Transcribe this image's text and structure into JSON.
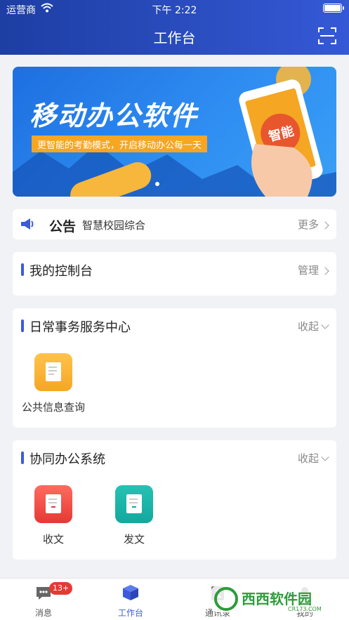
{
  "status_bar": {
    "carrier": "运营商",
    "time": "下午 2:22"
  },
  "header": {
    "title": "工作台",
    "scan_icon": "scan-icon"
  },
  "banner": {
    "title": "移动办公软件",
    "subtitle": "更智能的考勤模式，开启移动办公每一天",
    "phone_text": "智能",
    "page_count": 1,
    "current_page": 1
  },
  "notice": {
    "label": "公告",
    "text": "智慧校园综合",
    "more": "更多"
  },
  "console": {
    "title": "我的控制台",
    "action": "管理"
  },
  "daily": {
    "title": "日常事务服务中心",
    "action": "收起",
    "apps": [
      {
        "label": "公共信息查询",
        "color": "#f5a623",
        "icon": "document-search-icon"
      }
    ]
  },
  "collab": {
    "title": "协同办公系统",
    "action": "收起",
    "apps": [
      {
        "label": "收文",
        "color": "#e53935",
        "icon": "document-download-icon"
      },
      {
        "label": "发文",
        "color": "#13a89e",
        "icon": "document-upload-icon"
      }
    ]
  },
  "tabbar": {
    "tabs": [
      {
        "label": "消息",
        "icon": "message-icon",
        "badge": "13+"
      },
      {
        "label": "工作台",
        "icon": "workbench-cube-icon",
        "active": true
      },
      {
        "label": "通讯录",
        "icon": "contacts-icon"
      },
      {
        "label": "我的",
        "icon": "profile-icon"
      }
    ]
  },
  "watermark": {
    "text": "西西软件园",
    "url_text": "CR173.COM"
  },
  "colors": {
    "accent": "#3b5bdb",
    "header_start": "#1d3ea3",
    "header_end": "#3559d6",
    "badge": "#e53935"
  }
}
